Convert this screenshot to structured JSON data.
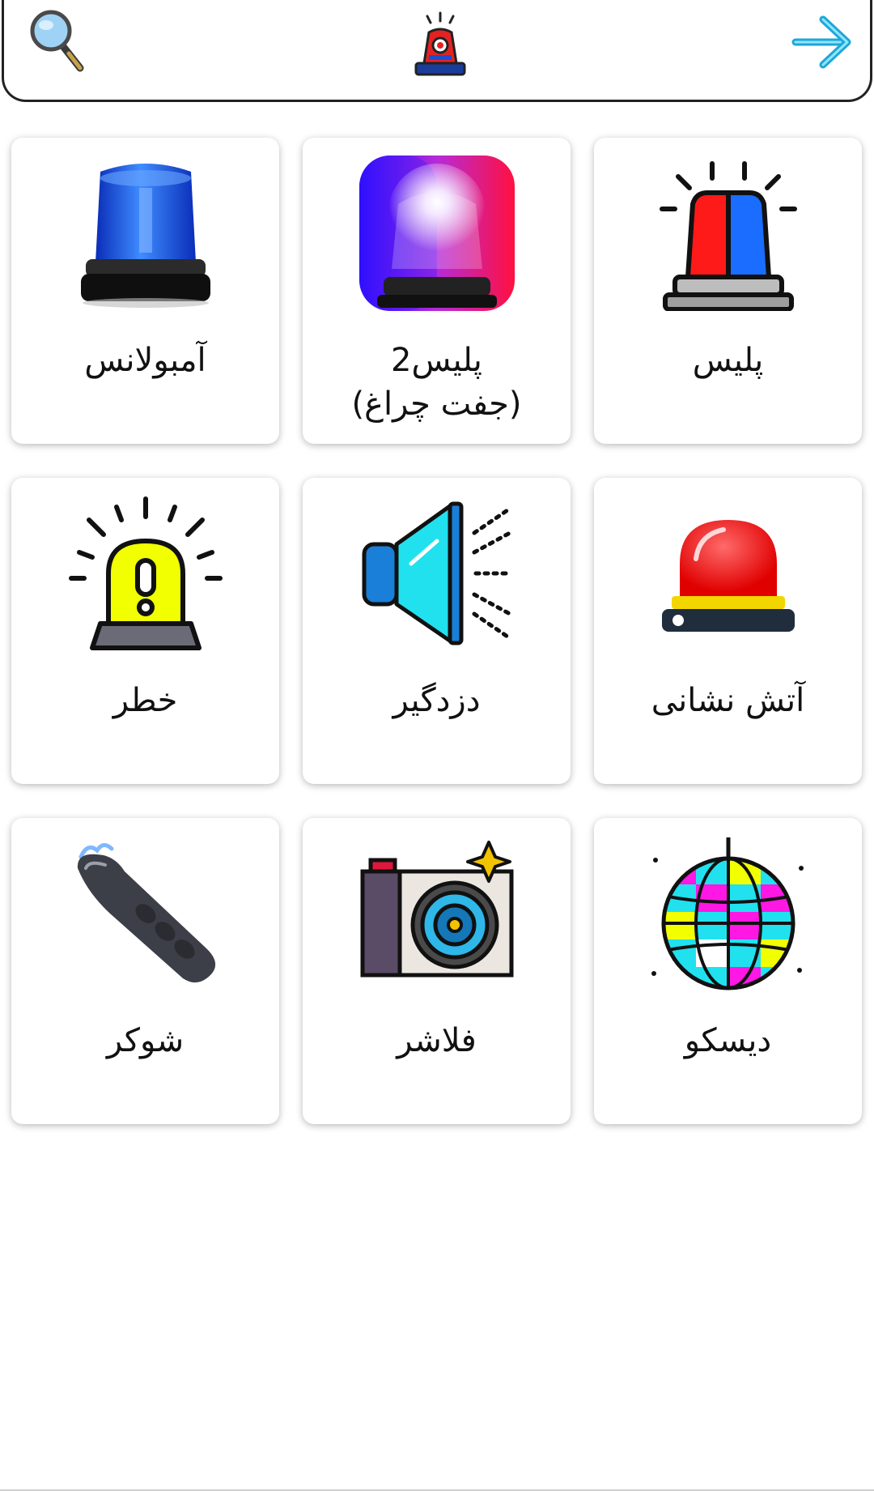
{
  "app": {
    "header": {
      "search_icon": "magnifier-icon",
      "logo_icon": "siren-logo-icon",
      "forward_icon": "arrow-right-icon"
    },
    "tiles": [
      {
        "label": "پلیس",
        "icon": "police-siren-icon"
      },
      {
        "label": "پلیس2\n(جفت چراغ)",
        "icon": "police-double-light-icon"
      },
      {
        "label": "آمبولانس",
        "icon": "ambulance-blue-beacon-icon"
      },
      {
        "label": "آتش نشانی",
        "icon": "fire-red-beacon-icon"
      },
      {
        "label": "دزدگیر",
        "icon": "alarm-speaker-icon"
      },
      {
        "label": "خطر",
        "icon": "danger-warning-light-icon"
      },
      {
        "label": "دیسکو",
        "icon": "disco-ball-icon"
      },
      {
        "label": "فلاشر",
        "icon": "camera-flash-icon"
      },
      {
        "label": "شوکر",
        "icon": "stun-gun-icon"
      }
    ],
    "colors": {
      "police_red": "#ff1a1a",
      "police_blue": "#1a6dff",
      "danger_yellow": "#f2ff00",
      "speaker_cyan": "#21e1ef",
      "disco_magenta": "#ff17e4"
    }
  }
}
